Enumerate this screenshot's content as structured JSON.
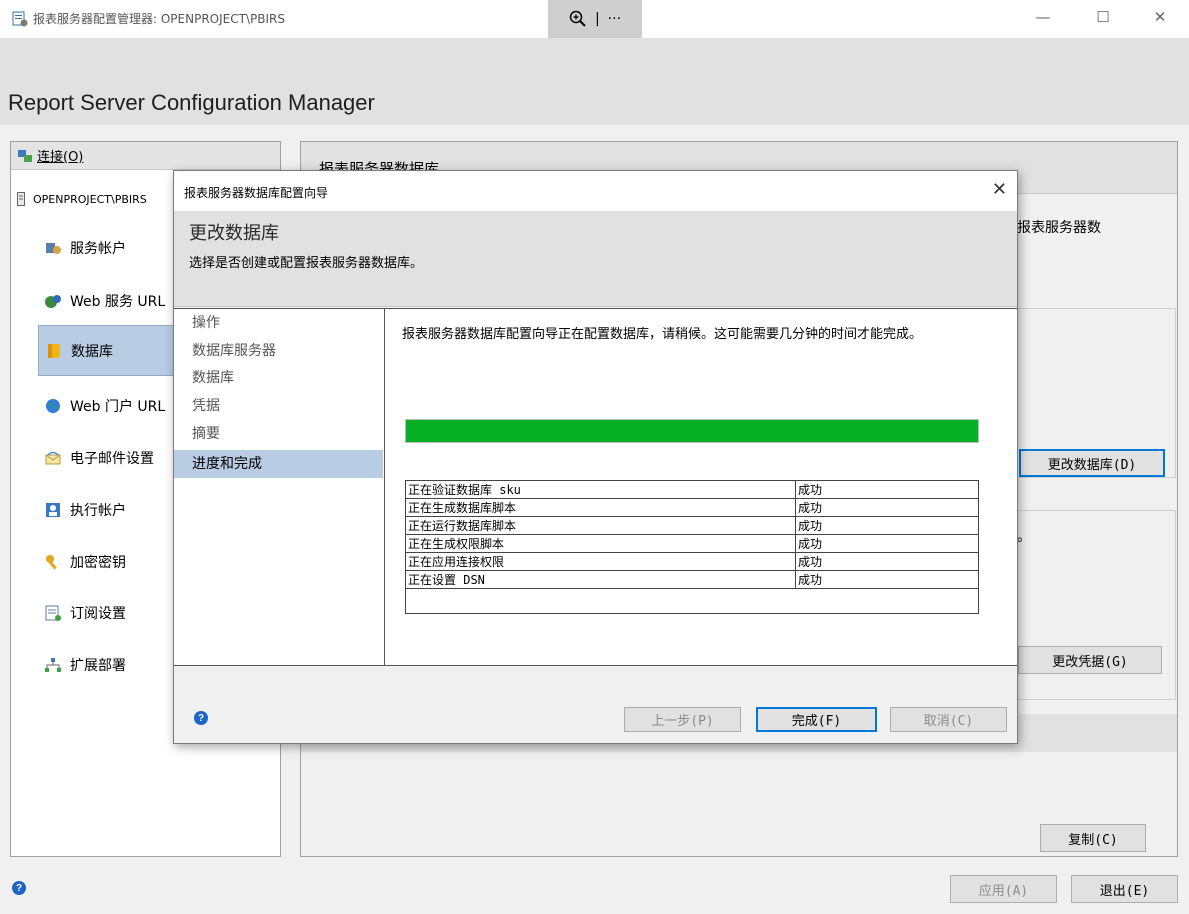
{
  "window": {
    "title": "报表服务器配置管理器: OPENPROJECT\\PBIRS",
    "zoom_icon": "zoom-in-icon",
    "more_label": "···",
    "minimize": "—",
    "maximize": "☐",
    "close": "✕"
  },
  "app_title": "Report Server Configuration Manager",
  "sidebar": {
    "connect_label": "连接(O)",
    "server_name": "OPENPROJECT\\PBIRS",
    "items": [
      {
        "label": "服务帐户",
        "icon": "service-account-icon"
      },
      {
        "label": "Web 服务 URL",
        "icon": "web-service-icon"
      },
      {
        "label": "数据库",
        "icon": "database-icon"
      },
      {
        "label": "Web 门户 URL",
        "icon": "globe-icon"
      },
      {
        "label": "电子邮件设置",
        "icon": "email-icon"
      },
      {
        "label": "执行帐户",
        "icon": "execution-account-icon"
      },
      {
        "label": "加密密钥",
        "icon": "key-icon"
      },
      {
        "label": "订阅设置",
        "icon": "subscription-icon"
      },
      {
        "label": "扩展部署",
        "icon": "scale-out-icon"
      }
    ],
    "selected_index": 2
  },
  "content": {
    "section_title": "报表服务器数据库",
    "partial_text_1": "报表服务器数",
    "partial_text_2": "。",
    "change_db_button": "更改数据库(D)",
    "change_cred_button": "更改凭据(G)",
    "copy_button": "复制(C)"
  },
  "footer": {
    "apply_button": "应用(A)",
    "exit_button": "退出(E)"
  },
  "dialog": {
    "title": "报表服务器数据库配置向导",
    "close": "✕",
    "header_title": "更改数据库",
    "header_subtitle": "选择是否创建或配置报表服务器数据库。",
    "steps": [
      "操作",
      "数据库服务器",
      "数据库",
      "凭据",
      "摘要",
      "进度和完成"
    ],
    "active_step": 5,
    "message": "报表服务器数据库配置向导正在配置数据库，请稍候。这可能需要几分钟的时间才能完成。",
    "progress_percent": 100,
    "status_rows": [
      {
        "task": "正在验证数据库 sku",
        "result": "成功"
      },
      {
        "task": "正在生成数据库脚本",
        "result": "成功"
      },
      {
        "task": "正在运行数据库脚本",
        "result": "成功"
      },
      {
        "task": "正在生成权限脚本",
        "result": "成功"
      },
      {
        "task": "正在应用连接权限",
        "result": "成功"
      },
      {
        "task": "正在设置 DSN",
        "result": "成功"
      }
    ],
    "back_button": "上一步(P)",
    "finish_button": "完成(F)",
    "cancel_button": "取消(C)"
  },
  "colors": {
    "progress": "#06b025",
    "selection": "#b8cce4",
    "focus_border": "#0078d7"
  }
}
